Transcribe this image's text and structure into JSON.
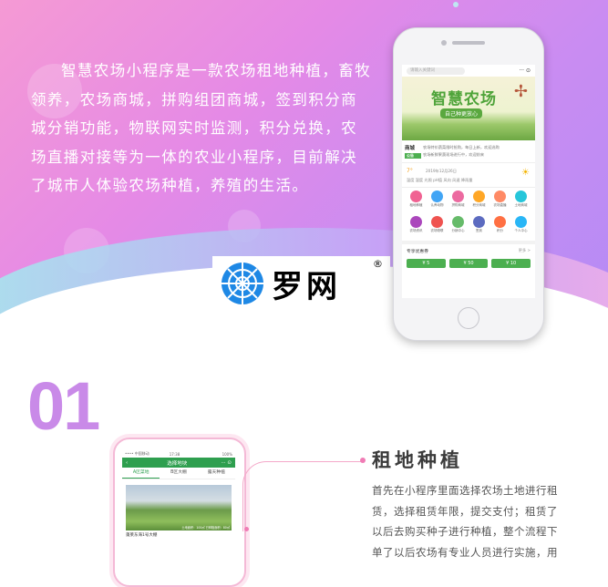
{
  "hero": {
    "description": "智慧农场小程序是一款农场租地种植，畜牧领养，农场商城，拼购组团商城，签到积分商城分销功能，物联网实时监测，积分兑换，农场直播对接等为一体的农业小程序，目前解决了城市人体验农场种植，养殖的生活。"
  },
  "watermark": {
    "brand_text": "罗网",
    "registered": "®"
  },
  "phone_main": {
    "search_placeholder": "请输入关键词",
    "menu_glyph": "··· ⊙",
    "banner_title": "智慧农场",
    "banner_subtitle": "自己种更放心",
    "news_tag": "商城",
    "news_badge": "公告",
    "news_lines": [
      "农场特价蔬菜限时抢购，每日上新，欢迎选购",
      "农场新鲜果蔬现场进行中，欢迎前来"
    ],
    "temp": "7°",
    "weather_date": "2019年12月26日",
    "weather_line": "温度 湿度 光照 pH值 风向 风速 降雨量",
    "grid": [
      {
        "label": "租地种植",
        "color": "#f06292"
      },
      {
        "label": "认养动物",
        "color": "#42a5f5"
      },
      {
        "label": "拼购商城",
        "color": "#ec6aa0"
      },
      {
        "label": "积分商城",
        "color": "#ffa726"
      },
      {
        "label": "农场直播",
        "color": "#ff8a65"
      },
      {
        "label": "土地商城",
        "color": "#26c6da"
      },
      {
        "label": "农场资讯",
        "color": "#ab47bc"
      },
      {
        "label": "农场物联",
        "color": "#ef5350"
      },
      {
        "label": "分销中心",
        "color": "#66bb6a"
      },
      {
        "label": "签到",
        "color": "#5c6bc0"
      },
      {
        "label": "积分",
        "color": "#ff7043"
      },
      {
        "label": "个人中心",
        "color": "#29b6f6"
      }
    ],
    "section_title": "专享优惠券",
    "section_more": "更多 >",
    "coupons": [
      "¥ 5",
      "¥ 50",
      "¥ 10"
    ]
  },
  "section01": {
    "number": "01",
    "title": "租地种植",
    "body": "首先在小程序里面选择农场土地进行租赁，选择租赁年限，提交支付；租赁了以后去购买种子进行种植，整个流程下单了以后农场有专业人员进行实施，用户可通过监控直播实时查看"
  },
  "phone_second": {
    "status_left": "•••• 中国移动",
    "status_center": "17:38",
    "status_right": "100%",
    "back_glyph": "‹",
    "nav_title": "选择地块",
    "nav_right": "··· ⊙",
    "tabs": [
      "A区菜地",
      "B区大棚",
      "露天种植"
    ],
    "image_caption": "土地面积：100㎡ 已种植面积：80㎡",
    "plot_name": "蓬莱东海1号大棚"
  }
}
